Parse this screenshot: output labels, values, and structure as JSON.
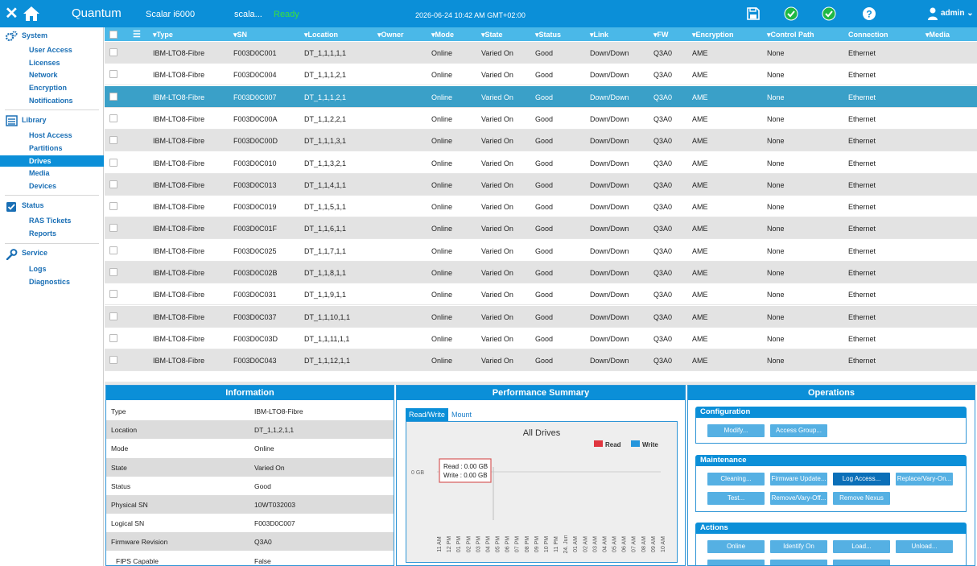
{
  "app": {
    "brand": "Quantum",
    "model": "Scalar i6000",
    "library_name": "scala...",
    "status": "Ready",
    "datetime": "2026-06-24 10:42 AM GMT+02:00",
    "user": "admin",
    "colors": {
      "accent": "#0b8fd8",
      "ready": "#39e03f",
      "check": "#1fb845"
    },
    "icons": [
      "close-icon",
      "home-icon",
      "save-icon",
      "check-icon",
      "check-icon",
      "help-icon",
      "user-icon",
      "chevron-down-icon"
    ]
  },
  "sidebar": {
    "sections": [
      {
        "label": "System",
        "icon": "gears-icon",
        "items": [
          "User Access",
          "Licenses",
          "Network",
          "Encryption",
          "Notifications"
        ]
      },
      {
        "label": "Library",
        "icon": "library-icon",
        "items": [
          "Host Access",
          "Partitions",
          "Drives",
          "Media",
          "Devices"
        ]
      },
      {
        "label": "Status",
        "icon": "checkbox-icon",
        "items": [
          "RAS Tickets",
          "Reports"
        ]
      },
      {
        "label": "Service",
        "icon": "wrench-icon",
        "items": [
          "Logs",
          "Diagnostics"
        ]
      }
    ],
    "active_item": "Drives"
  },
  "grid": {
    "columns": [
      "Type",
      "SN",
      "Location",
      "Owner",
      "Mode",
      "State",
      "Status",
      "Link",
      "FW",
      "Encryption",
      "Control Path",
      "Connection",
      "Media"
    ],
    "rows": [
      {
        "type": "IBM-LTO8-Fibre",
        "sn": "F003D0C001",
        "location": "DT_1,1,1,1,1",
        "owner": "",
        "mode": "Online",
        "state": "Varied On",
        "status": "Good",
        "link": "Down/Down",
        "fw": "Q3A0",
        "encryption": "AME",
        "control_path": "None",
        "connection": "Ethernet"
      },
      {
        "type": "IBM-LTO8-Fibre",
        "sn": "F003D0C004",
        "location": "DT_1,1,1,2,1",
        "owner": "",
        "mode": "Online",
        "state": "Varied On",
        "status": "Good",
        "link": "Down/Down",
        "fw": "Q3A0",
        "encryption": "AME",
        "control_path": "None",
        "connection": "Ethernet"
      },
      {
        "type": "IBM-LTO8-Fibre",
        "sn": "F003D0C007",
        "location": "DT_1,1,1,2,1",
        "owner": "",
        "mode": "Online",
        "state": "Varied On",
        "status": "Good",
        "link": "Down/Down",
        "fw": "Q3A0",
        "encryption": "AME",
        "control_path": "None",
        "connection": "Ethernet"
      },
      {
        "type": "IBM-LTO8-Fibre",
        "sn": "F003D0C00A",
        "location": "DT_1,1,2,2,1",
        "owner": "",
        "mode": "Online",
        "state": "Varied On",
        "status": "Good",
        "link": "Down/Down",
        "fw": "Q3A0",
        "encryption": "AME",
        "control_path": "None",
        "connection": "Ethernet"
      },
      {
        "type": "IBM-LTO8-Fibre",
        "sn": "F003D0C00D",
        "location": "DT_1,1,1,3,1",
        "owner": "",
        "mode": "Online",
        "state": "Varied On",
        "status": "Good",
        "link": "Down/Down",
        "fw": "Q3A0",
        "encryption": "AME",
        "control_path": "None",
        "connection": "Ethernet"
      },
      {
        "type": "IBM-LTO8-Fibre",
        "sn": "F003D0C010",
        "location": "DT_1,1,3,2,1",
        "owner": "",
        "mode": "Online",
        "state": "Varied On",
        "status": "Good",
        "link": "Down/Down",
        "fw": "Q3A0",
        "encryption": "AME",
        "control_path": "None",
        "connection": "Ethernet"
      },
      {
        "type": "IBM-LTO8-Fibre",
        "sn": "F003D0C013",
        "location": "DT_1,1,4,1,1",
        "owner": "",
        "mode": "Online",
        "state": "Varied On",
        "status": "Good",
        "link": "Down/Down",
        "fw": "Q3A0",
        "encryption": "AME",
        "control_path": "None",
        "connection": "Ethernet"
      },
      {
        "type": "IBM-LTO8-Fibre",
        "sn": "F003D0C019",
        "location": "DT_1,1,5,1,1",
        "owner": "",
        "mode": "Online",
        "state": "Varied On",
        "status": "Good",
        "link": "Down/Down",
        "fw": "Q3A0",
        "encryption": "AME",
        "control_path": "None",
        "connection": "Ethernet"
      },
      {
        "type": "IBM-LTO8-Fibre",
        "sn": "F003D0C01F",
        "location": "DT_1,1,6,1,1",
        "owner": "",
        "mode": "Online",
        "state": "Varied On",
        "status": "Good",
        "link": "Down/Down",
        "fw": "Q3A0",
        "encryption": "AME",
        "control_path": "None",
        "connection": "Ethernet"
      },
      {
        "type": "IBM-LTO8-Fibre",
        "sn": "F003D0C025",
        "location": "DT_1,1,7,1,1",
        "owner": "",
        "mode": "Online",
        "state": "Varied On",
        "status": "Good",
        "link": "Down/Down",
        "fw": "Q3A0",
        "encryption": "AME",
        "control_path": "None",
        "connection": "Ethernet"
      },
      {
        "type": "IBM-LTO8-Fibre",
        "sn": "F003D0C02B",
        "location": "DT_1,1,8,1,1",
        "owner": "",
        "mode": "Online",
        "state": "Varied On",
        "status": "Good",
        "link": "Down/Down",
        "fw": "Q3A0",
        "encryption": "AME",
        "control_path": "None",
        "connection": "Ethernet"
      },
      {
        "type": "IBM-LTO8-Fibre",
        "sn": "F003D0C031",
        "location": "DT_1,1,9,1,1",
        "owner": "",
        "mode": "Online",
        "state": "Varied On",
        "status": "Good",
        "link": "Down/Down",
        "fw": "Q3A0",
        "encryption": "AME",
        "control_path": "None",
        "connection": "Ethernet"
      },
      {
        "type": "IBM-LTO8-Fibre",
        "sn": "F003D0C037",
        "location": "DT_1,1,10,1,1",
        "owner": "",
        "mode": "Online",
        "state": "Varied On",
        "status": "Good",
        "link": "Down/Down",
        "fw": "Q3A0",
        "encryption": "AME",
        "control_path": "None",
        "connection": "Ethernet"
      },
      {
        "type": "IBM-LTO8-Fibre",
        "sn": "F003D0C03D",
        "location": "DT_1,1,11,1,1",
        "owner": "",
        "mode": "Online",
        "state": "Varied On",
        "status": "Good",
        "link": "Down/Down",
        "fw": "Q3A0",
        "encryption": "AME",
        "control_path": "None",
        "connection": "Ethernet"
      },
      {
        "type": "IBM-LTO8-Fibre",
        "sn": "F003D0C043",
        "location": "DT_1,1,12,1,1",
        "owner": "",
        "mode": "Online",
        "state": "Varied On",
        "status": "Good",
        "link": "Down/Down",
        "fw": "Q3A0",
        "encryption": "AME",
        "control_path": "None",
        "connection": "Ethernet"
      }
    ],
    "selected_row": 2
  },
  "information": {
    "title": "Information",
    "rows": [
      {
        "label": "Type",
        "value": "IBM-LTO8-Fibre"
      },
      {
        "label": "Location",
        "value": "DT_1,1,2,1,1"
      },
      {
        "label": "Mode",
        "value": "Online"
      },
      {
        "label": "State",
        "value": "Varied On"
      },
      {
        "label": "Status",
        "value": "Good"
      },
      {
        "label": "Physical SN",
        "value": "10WT032003"
      },
      {
        "label": "Logical SN",
        "value": "F003D0C007"
      },
      {
        "label": "Firmware Revision",
        "value": "Q3A0"
      },
      {
        "label": "FIPS Capable",
        "value": "False"
      }
    ]
  },
  "performance": {
    "title": "Performance Summary",
    "tabs": [
      "Read/Write",
      "Mount"
    ],
    "active_tab": "Read/Write",
    "chart_data": {
      "type": "line",
      "title": "All Drives",
      "xlabel": "",
      "ylabel": "",
      "x": [
        "11 AM",
        "12 PM",
        "01 PM",
        "02 PM",
        "03 PM",
        "04 PM",
        "05 PM",
        "06 PM",
        "07 PM",
        "08 PM",
        "09 PM",
        "10 PM",
        "11 PM",
        "24. Jun",
        "01 AM",
        "02 AM",
        "03 AM",
        "04 AM",
        "05 AM",
        "06 AM",
        "07 AM",
        "08 AM",
        "09 AM",
        "10 AM"
      ],
      "y_ticks": [
        "0 GB"
      ],
      "series": [
        {
          "name": "Read",
          "color": "#e0363f",
          "values": [
            0,
            0,
            0,
            0,
            0,
            0,
            0,
            0,
            0,
            0,
            0,
            0,
            0,
            0,
            0,
            0,
            0,
            0,
            0,
            0,
            0,
            0,
            0,
            0
          ]
        },
        {
          "name": "Write",
          "color": "#2696dc",
          "values": [
            0,
            0,
            0,
            0,
            0,
            0,
            0,
            0,
            0,
            0,
            0,
            0,
            0,
            0,
            0,
            0,
            0,
            0,
            0,
            0,
            0,
            0,
            0,
            0
          ]
        }
      ],
      "legend": "top-right",
      "tooltip": {
        "read": "Read : 0.00 GB",
        "write": "Write : 0.00 GB"
      }
    }
  },
  "operations": {
    "title": "Operations",
    "groups": [
      {
        "label": "Configuration",
        "buttons": [
          "Modify...",
          "Access Group..."
        ]
      },
      {
        "label": "Maintenance",
        "buttons": [
          "Cleaning...",
          "Firmware Update...",
          "Log Access...",
          "Replace/Vary-On...",
          "Test...",
          "Remove/Vary-Off...",
          "Remove Nexus"
        ]
      },
      {
        "label": "Actions",
        "buttons": [
          "Online",
          "Identify On",
          "Load...",
          "Unload..."
        ]
      }
    ]
  }
}
